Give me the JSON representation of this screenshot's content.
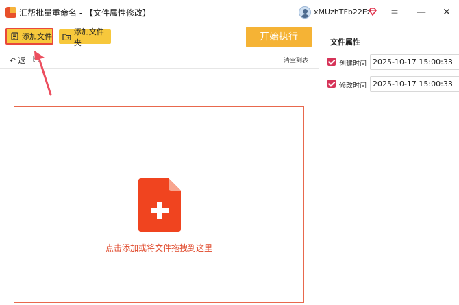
{
  "window": {
    "title": "汇帮批量重命名 - 【文件属性修改】",
    "username": "xMUzhTFb22Ez",
    "icons": {
      "logo": "app-logo",
      "avatar": "user-avatar",
      "vip": "vip-diamond-icon",
      "menu": "hamburger-menu-icon",
      "minimize": "minimize-icon",
      "close": "close-icon"
    },
    "menu_glyph": "≡",
    "minimize_glyph": "—",
    "close_glyph": "✕"
  },
  "toolbar": {
    "add_file_label": "添加文件",
    "add_folder_label": "添加文件夹",
    "start_label": "开始执行",
    "accent_color": "#f7c83c",
    "highlight_color": "#e8483b"
  },
  "subbar": {
    "undo_label": "返",
    "undo_glyph": "↶",
    "redo_glyph": "⎘",
    "clear_label": "清空列表"
  },
  "dropzone": {
    "hint": "点击添加或将文件拖拽到这里",
    "icon": "add-file-icon",
    "color": "#e04a2c"
  },
  "panel": {
    "title": "文件属性",
    "attributes": [
      {
        "label": "创建时间",
        "checked": true,
        "value": "2025-10-17 15:00:33"
      },
      {
        "label": "修改时间",
        "checked": true,
        "value": "2025-10-17 15:00:33"
      }
    ],
    "check_color": "#d63358"
  }
}
